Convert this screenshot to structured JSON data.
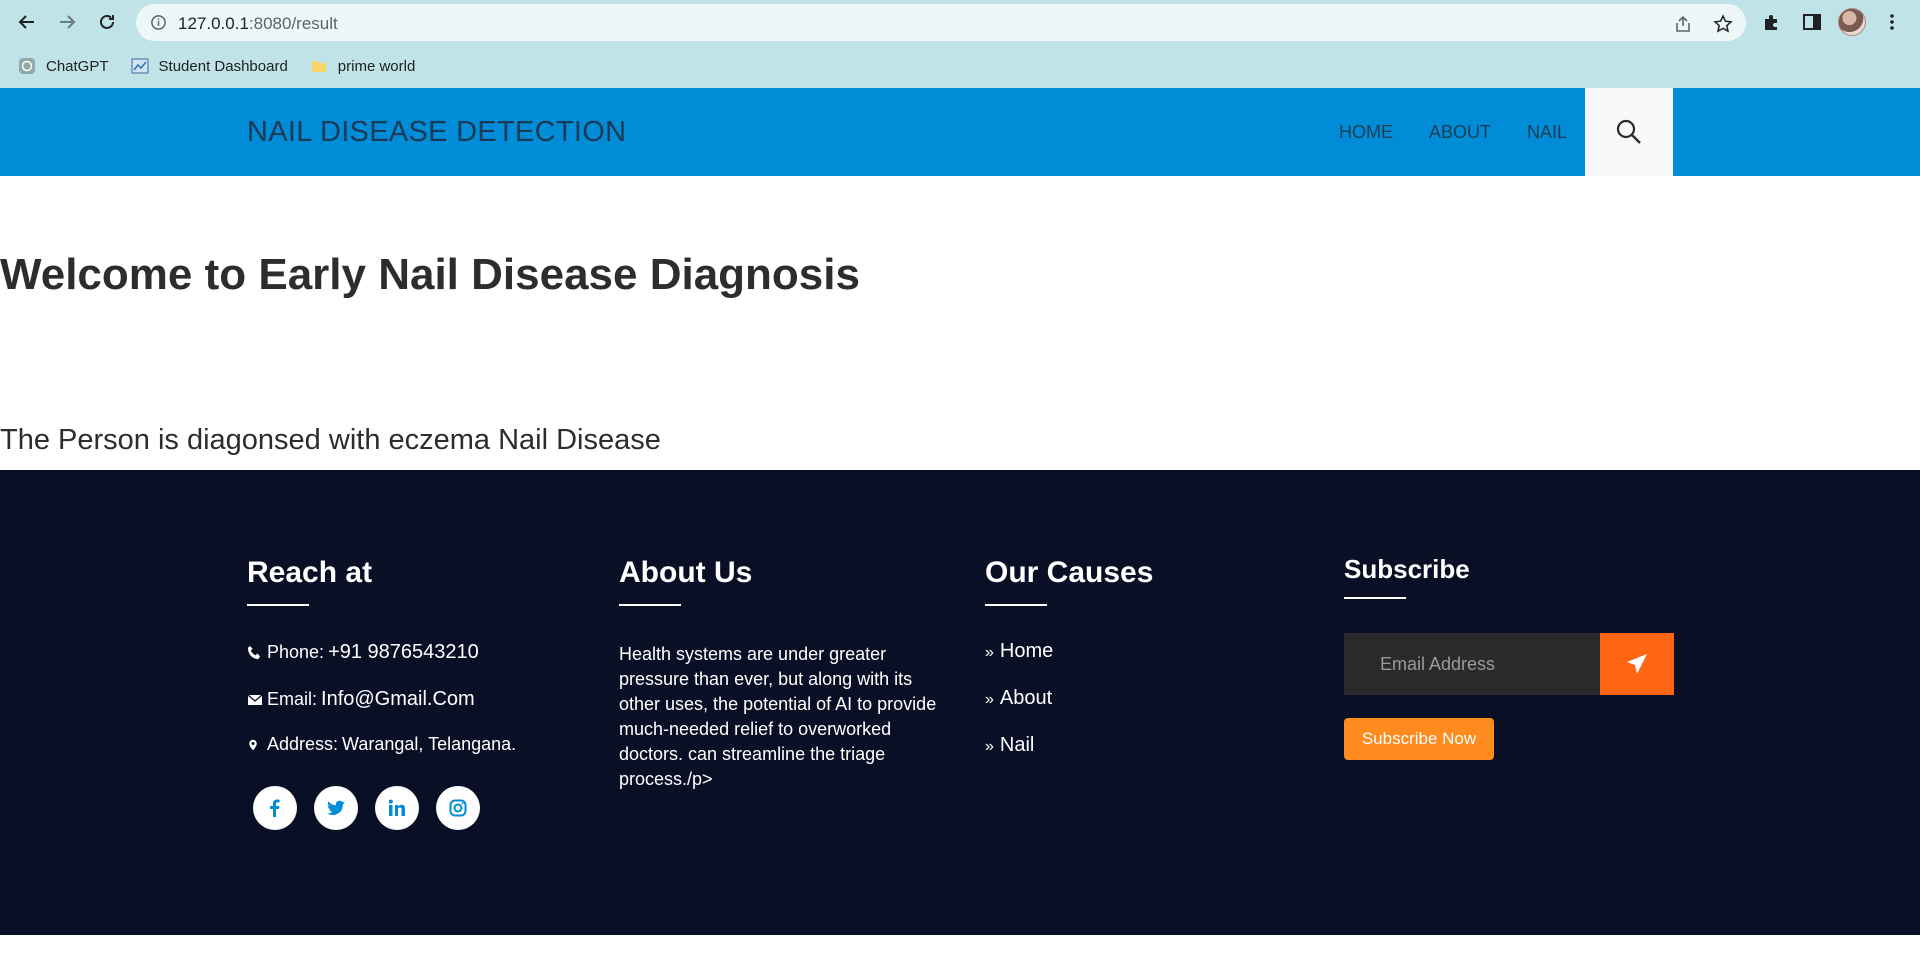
{
  "browser": {
    "url_host": "127.0.0.1",
    "url_path": ":8080/result",
    "bookmarks": [
      {
        "label": "ChatGPT",
        "icon": "chatgpt-icon"
      },
      {
        "label": "Student Dashboard",
        "icon": "dashboard-icon"
      },
      {
        "label": "prime world",
        "icon": "folder-icon"
      }
    ]
  },
  "header": {
    "brand": "NAIL DISEASE DETECTION",
    "menu": [
      "HOME",
      "ABOUT",
      "NAIL"
    ],
    "search_icon": "search-icon"
  },
  "main": {
    "welcome": "Welcome to Early Nail Disease Diagnosis",
    "result": "The Person is diagonsed with eczema Nail Disease"
  },
  "footer": {
    "reach": {
      "title": "Reach at",
      "phone_label": "Phone:",
      "phone_value": "+91 9876543210",
      "email_label": "Email:",
      "email_value": "Info@Gmail.Com",
      "address_label": "Address:",
      "address_value": "Warangal, Telangana.",
      "socials": [
        "facebook-icon",
        "twitter-icon",
        "linkedin-icon",
        "instagram-icon"
      ]
    },
    "about": {
      "title": "About Us",
      "text": "Health systems are under greater pressure than ever, but along with its other uses, the potential of AI to provide much-needed relief to overworked doctors. can streamline the triage process./p>"
    },
    "causes": {
      "title": "Our Causes",
      "items": [
        "Home",
        "About",
        "Nail"
      ]
    },
    "subscribe": {
      "title": "Subscribe",
      "email_placeholder": "Email Address",
      "button": "Subscribe Now"
    }
  },
  "colors": {
    "header_bg": "#008cd6",
    "footer_bg": "#090f25",
    "send_button": "#ff6412",
    "subscribe_button": "#ff8a1e"
  }
}
